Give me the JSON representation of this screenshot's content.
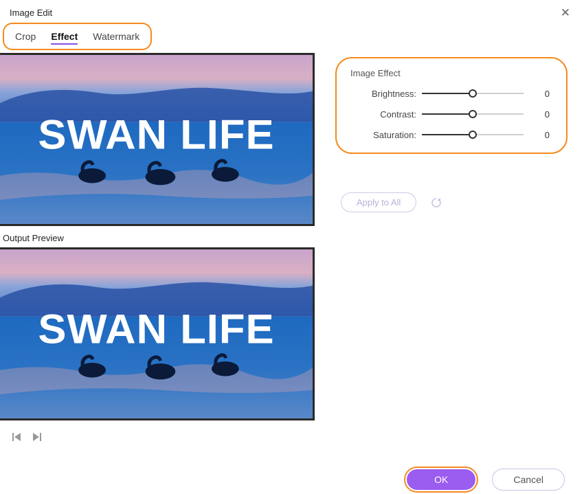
{
  "window": {
    "title": "Image Edit"
  },
  "tabs": {
    "crop": "Crop",
    "effect": "Effect",
    "watermark": "Watermark"
  },
  "preview": {
    "overlay_text": "SWAN LIFE",
    "output_label": "Output Preview"
  },
  "effect": {
    "title": "Image Effect",
    "brightness_label": "Brightness:",
    "brightness_value": "0",
    "contrast_label": "Contrast:",
    "contrast_value": "0",
    "saturation_label": "Saturation:",
    "saturation_value": "0"
  },
  "actions": {
    "apply_all": "Apply to All",
    "ok": "OK",
    "cancel": "Cancel"
  }
}
